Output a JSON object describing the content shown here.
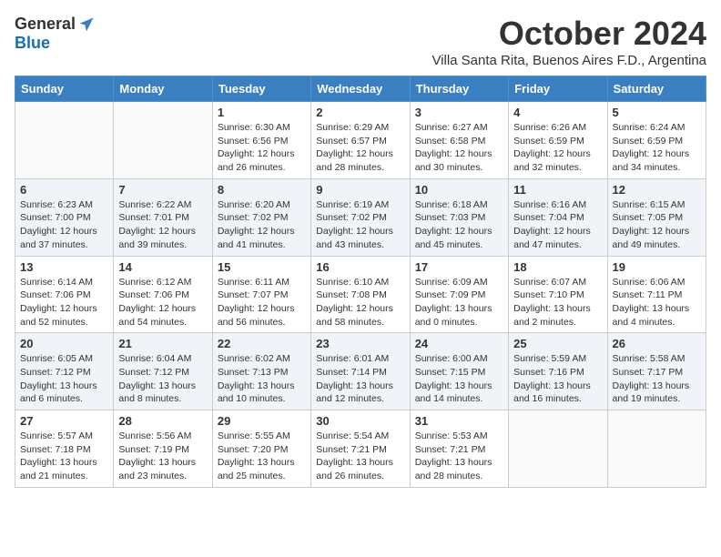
{
  "logo": {
    "general": "General",
    "blue": "Blue"
  },
  "title": "October 2024",
  "location": "Villa Santa Rita, Buenos Aires F.D., Argentina",
  "days_of_week": [
    "Sunday",
    "Monday",
    "Tuesday",
    "Wednesday",
    "Thursday",
    "Friday",
    "Saturday"
  ],
  "weeks": [
    [
      {
        "day": "",
        "sunrise": "",
        "sunset": "",
        "daylight": ""
      },
      {
        "day": "",
        "sunrise": "",
        "sunset": "",
        "daylight": ""
      },
      {
        "day": "1",
        "sunrise": "Sunrise: 6:30 AM",
        "sunset": "Sunset: 6:56 PM",
        "daylight": "Daylight: 12 hours and 26 minutes."
      },
      {
        "day": "2",
        "sunrise": "Sunrise: 6:29 AM",
        "sunset": "Sunset: 6:57 PM",
        "daylight": "Daylight: 12 hours and 28 minutes."
      },
      {
        "day": "3",
        "sunrise": "Sunrise: 6:27 AM",
        "sunset": "Sunset: 6:58 PM",
        "daylight": "Daylight: 12 hours and 30 minutes."
      },
      {
        "day": "4",
        "sunrise": "Sunrise: 6:26 AM",
        "sunset": "Sunset: 6:59 PM",
        "daylight": "Daylight: 12 hours and 32 minutes."
      },
      {
        "day": "5",
        "sunrise": "Sunrise: 6:24 AM",
        "sunset": "Sunset: 6:59 PM",
        "daylight": "Daylight: 12 hours and 34 minutes."
      }
    ],
    [
      {
        "day": "6",
        "sunrise": "Sunrise: 6:23 AM",
        "sunset": "Sunset: 7:00 PM",
        "daylight": "Daylight: 12 hours and 37 minutes."
      },
      {
        "day": "7",
        "sunrise": "Sunrise: 6:22 AM",
        "sunset": "Sunset: 7:01 PM",
        "daylight": "Daylight: 12 hours and 39 minutes."
      },
      {
        "day": "8",
        "sunrise": "Sunrise: 6:20 AM",
        "sunset": "Sunset: 7:02 PM",
        "daylight": "Daylight: 12 hours and 41 minutes."
      },
      {
        "day": "9",
        "sunrise": "Sunrise: 6:19 AM",
        "sunset": "Sunset: 7:02 PM",
        "daylight": "Daylight: 12 hours and 43 minutes."
      },
      {
        "day": "10",
        "sunrise": "Sunrise: 6:18 AM",
        "sunset": "Sunset: 7:03 PM",
        "daylight": "Daylight: 12 hours and 45 minutes."
      },
      {
        "day": "11",
        "sunrise": "Sunrise: 6:16 AM",
        "sunset": "Sunset: 7:04 PM",
        "daylight": "Daylight: 12 hours and 47 minutes."
      },
      {
        "day": "12",
        "sunrise": "Sunrise: 6:15 AM",
        "sunset": "Sunset: 7:05 PM",
        "daylight": "Daylight: 12 hours and 49 minutes."
      }
    ],
    [
      {
        "day": "13",
        "sunrise": "Sunrise: 6:14 AM",
        "sunset": "Sunset: 7:06 PM",
        "daylight": "Daylight: 12 hours and 52 minutes."
      },
      {
        "day": "14",
        "sunrise": "Sunrise: 6:12 AM",
        "sunset": "Sunset: 7:06 PM",
        "daylight": "Daylight: 12 hours and 54 minutes."
      },
      {
        "day": "15",
        "sunrise": "Sunrise: 6:11 AM",
        "sunset": "Sunset: 7:07 PM",
        "daylight": "Daylight: 12 hours and 56 minutes."
      },
      {
        "day": "16",
        "sunrise": "Sunrise: 6:10 AM",
        "sunset": "Sunset: 7:08 PM",
        "daylight": "Daylight: 12 hours and 58 minutes."
      },
      {
        "day": "17",
        "sunrise": "Sunrise: 6:09 AM",
        "sunset": "Sunset: 7:09 PM",
        "daylight": "Daylight: 13 hours and 0 minutes."
      },
      {
        "day": "18",
        "sunrise": "Sunrise: 6:07 AM",
        "sunset": "Sunset: 7:10 PM",
        "daylight": "Daylight: 13 hours and 2 minutes."
      },
      {
        "day": "19",
        "sunrise": "Sunrise: 6:06 AM",
        "sunset": "Sunset: 7:11 PM",
        "daylight": "Daylight: 13 hours and 4 minutes."
      }
    ],
    [
      {
        "day": "20",
        "sunrise": "Sunrise: 6:05 AM",
        "sunset": "Sunset: 7:12 PM",
        "daylight": "Daylight: 13 hours and 6 minutes."
      },
      {
        "day": "21",
        "sunrise": "Sunrise: 6:04 AM",
        "sunset": "Sunset: 7:12 PM",
        "daylight": "Daylight: 13 hours and 8 minutes."
      },
      {
        "day": "22",
        "sunrise": "Sunrise: 6:02 AM",
        "sunset": "Sunset: 7:13 PM",
        "daylight": "Daylight: 13 hours and 10 minutes."
      },
      {
        "day": "23",
        "sunrise": "Sunrise: 6:01 AM",
        "sunset": "Sunset: 7:14 PM",
        "daylight": "Daylight: 13 hours and 12 minutes."
      },
      {
        "day": "24",
        "sunrise": "Sunrise: 6:00 AM",
        "sunset": "Sunset: 7:15 PM",
        "daylight": "Daylight: 13 hours and 14 minutes."
      },
      {
        "day": "25",
        "sunrise": "Sunrise: 5:59 AM",
        "sunset": "Sunset: 7:16 PM",
        "daylight": "Daylight: 13 hours and 16 minutes."
      },
      {
        "day": "26",
        "sunrise": "Sunrise: 5:58 AM",
        "sunset": "Sunset: 7:17 PM",
        "daylight": "Daylight: 13 hours and 19 minutes."
      }
    ],
    [
      {
        "day": "27",
        "sunrise": "Sunrise: 5:57 AM",
        "sunset": "Sunset: 7:18 PM",
        "daylight": "Daylight: 13 hours and 21 minutes."
      },
      {
        "day": "28",
        "sunrise": "Sunrise: 5:56 AM",
        "sunset": "Sunset: 7:19 PM",
        "daylight": "Daylight: 13 hours and 23 minutes."
      },
      {
        "day": "29",
        "sunrise": "Sunrise: 5:55 AM",
        "sunset": "Sunset: 7:20 PM",
        "daylight": "Daylight: 13 hours and 25 minutes."
      },
      {
        "day": "30",
        "sunrise": "Sunrise: 5:54 AM",
        "sunset": "Sunset: 7:21 PM",
        "daylight": "Daylight: 13 hours and 26 minutes."
      },
      {
        "day": "31",
        "sunrise": "Sunrise: 5:53 AM",
        "sunset": "Sunset: 7:21 PM",
        "daylight": "Daylight: 13 hours and 28 minutes."
      },
      {
        "day": "",
        "sunrise": "",
        "sunset": "",
        "daylight": ""
      },
      {
        "day": "",
        "sunrise": "",
        "sunset": "",
        "daylight": ""
      }
    ]
  ]
}
